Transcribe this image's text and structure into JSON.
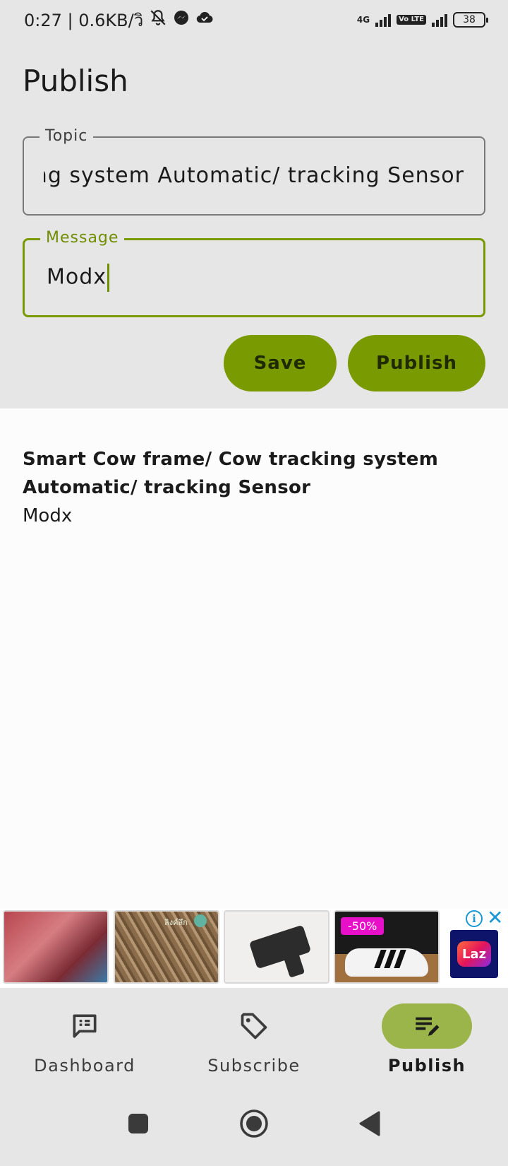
{
  "status_bar": {
    "time_and_speed": "0:27 | 0.6KB/วิ",
    "network_label": "4G",
    "volte_label": "Vo LTE",
    "battery": "38"
  },
  "page": {
    "title": "Publish"
  },
  "form": {
    "topic_label": "Topic",
    "topic_value": "Smart Cow frame/ Cow tracking system Automatic/ tracking Sensor",
    "message_label": "Message",
    "message_value": "Modx",
    "save_label": "Save",
    "publish_label": "Publish"
  },
  "messages": [
    {
      "topic": "Smart Cow frame/ Cow tracking system Automatic/ tracking Sensor",
      "text": "Modx"
    }
  ],
  "ad": {
    "discount": "-50%",
    "brand": "Laz",
    "tile_caption": "ลิงค์ลึก"
  },
  "bottom_nav": {
    "items": [
      {
        "label": "Dashboard",
        "icon": "dashboard-icon",
        "active": false
      },
      {
        "label": "Subscribe",
        "icon": "tag-icon",
        "active": false
      },
      {
        "label": "Publish",
        "icon": "publish-edit-icon",
        "active": true
      }
    ]
  },
  "colors": {
    "accent": "#7a9a01",
    "accent_pill": "#9bb54a",
    "surface": "#e6e6e6",
    "background": "#fcfcfc"
  }
}
